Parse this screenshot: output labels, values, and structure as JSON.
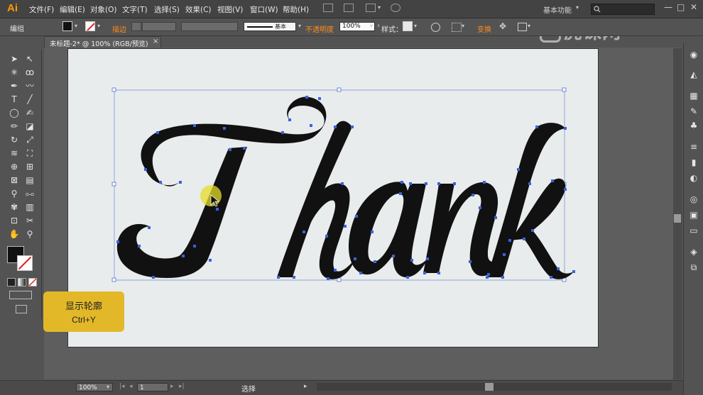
{
  "app": {
    "logo": "Ai"
  },
  "menu": {
    "items": [
      "文件(F)",
      "编辑(E)",
      "对象(O)",
      "文字(T)",
      "选择(S)",
      "效果(C)",
      "视图(V)",
      "窗口(W)",
      "帮助(H)"
    ],
    "workspace": "基本功能",
    "window_buttons": [
      "—",
      "□",
      "✕"
    ]
  },
  "watermark": "虎课网",
  "control": {
    "selection_label": "编组",
    "stroke_link": "描边",
    "stroke_style_label": "基本",
    "opacity_link": "不透明度",
    "opacity_value": "100%",
    "style_label": "样式：",
    "transform_link": "变换"
  },
  "document": {
    "tab_title": "未标题-2* @ 100% (RGB/预览)",
    "close": "×"
  },
  "hint": {
    "title": "显示轮廓",
    "shortcut": "Ctrl+Y"
  },
  "status": {
    "zoom": "100%",
    "page": "1",
    "tool": "选择"
  },
  "artwork": {
    "text": "Thank"
  },
  "colors": {
    "accent": "#ff9a00",
    "hint_bg": "#e2b828",
    "anchor": "#3a62d9",
    "fill": "#111111"
  },
  "icons": {
    "tools": [
      "selection-tool-icon",
      "direct-selection-tool-icon",
      "magic-wand-tool-icon",
      "lasso-tool-icon",
      "pen-tool-icon",
      "curvature-tool-icon",
      "type-tool-icon",
      "line-tool-icon",
      "ellipse-tool-icon",
      "paintbrush-tool-icon",
      "pencil-tool-icon",
      "eraser-tool-icon",
      "rotate-tool-icon",
      "scale-tool-icon",
      "width-tool-icon",
      "free-transform-tool-icon",
      "shape-builder-tool-icon",
      "perspective-grid-tool-icon",
      "mesh-tool-icon",
      "gradient-tool-icon",
      "eyedropper-tool-icon",
      "blend-tool-icon",
      "symbol-sprayer-tool-icon",
      "column-graph-tool-icon",
      "artboard-tool-icon",
      "slice-tool-icon",
      "hand-tool-icon",
      "zoom-tool-icon"
    ]
  }
}
